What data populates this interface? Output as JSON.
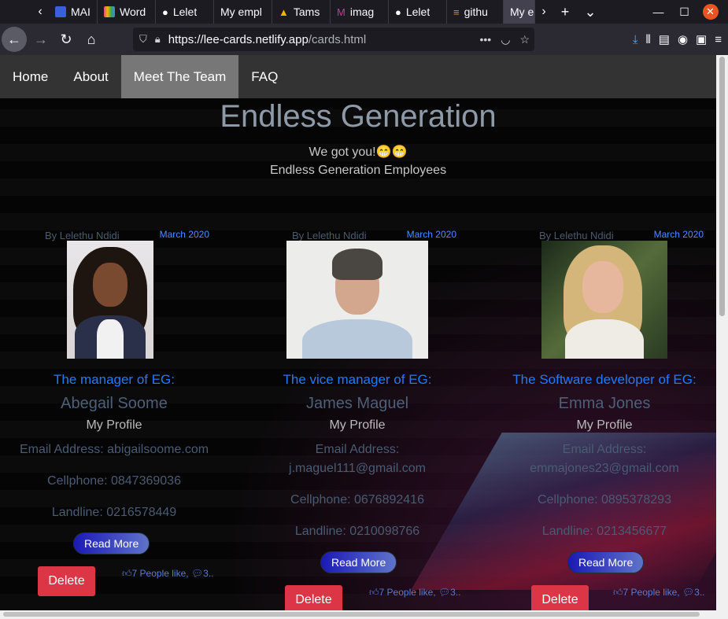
{
  "browser": {
    "tabs": [
      {
        "label": "MAIN",
        "color": "#3b5fd9"
      },
      {
        "label": "Word",
        "color": "#e04b8a"
      },
      {
        "label": "Lelet",
        "color": "#fbfbfe"
      },
      {
        "label": "My empl",
        "color": ""
      },
      {
        "label": "Tams",
        "color": "#f4b400"
      },
      {
        "label": "imag",
        "color": "#c43c8e"
      },
      {
        "label": "Lelet",
        "color": "#fbfbfe"
      },
      {
        "label": "githu",
        "color": "#f48024"
      },
      {
        "label": "My e",
        "color": ""
      }
    ],
    "url_host": "https://lee-cards.netlify.app",
    "url_path": "/cards.html"
  },
  "site": {
    "nav": [
      "Home",
      "About",
      "Meet The Team",
      "FAQ"
    ],
    "title": "Endless Generation",
    "tagline": "We got you!😁😁",
    "subtitle": "Endless Generation Employees"
  },
  "cards": [
    {
      "by": "By Lelethu Ndidi",
      "date": "March 2020",
      "role": "The manager of EG:",
      "name": "Abegail Soome",
      "profile": "My Profile",
      "email_line": "Email Address: abigailsoome.com",
      "email_label": "",
      "cellphone": "Cellphone: 0847369036",
      "landline": "Landline: 0216578449",
      "read_more": "Read More",
      "delete": "Delete",
      "likes": "7 People like, ",
      "comments": "3.."
    },
    {
      "by": "By Lelethu Ndidi",
      "date": "March 2020",
      "role": "The vice manager of EG:",
      "name": "James Maguel",
      "profile": "My Profile",
      "email_label": "Email Address:",
      "email_line": "j.maguel111@gmail.com",
      "cellphone": "Cellphone: 0676892416",
      "landline": "Landline: 0210098766",
      "read_more": "Read More",
      "delete": "Delete",
      "likes": "7 People like, ",
      "comments": "3.."
    },
    {
      "by": "By Lelethu Ndidi",
      "date": "March 2020",
      "role": "The Software developer of EG:",
      "name": "Emma Jones",
      "profile": "My Profile",
      "email_label": "Email Address:",
      "email_line": "emmajones23@gmail.com",
      "cellphone": "Cellphone: 0895378293",
      "landline": "Landline: 0213456677",
      "read_more": "Read More",
      "delete": "Delete",
      "likes": "7 People like, ",
      "comments": "3.."
    }
  ]
}
